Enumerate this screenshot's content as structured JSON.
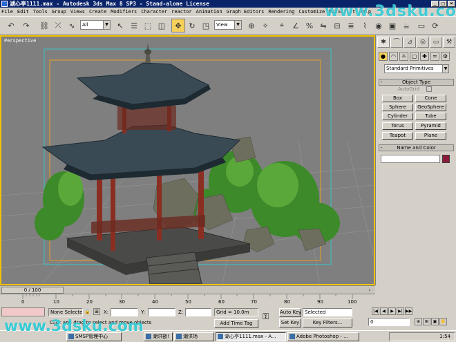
{
  "window": {
    "title": "湖心亭1111.max - Autodesk 3ds Max 8 SP3 - Stand-alone License",
    "min": "_",
    "max": "□",
    "close": "×"
  },
  "menu": [
    "File",
    "Edit",
    "Tools",
    "Group",
    "Views",
    "Create",
    "Modifiers",
    "Character",
    "reactor",
    "Animation",
    "Graph Editors",
    "Rendering",
    "Customize",
    "MAXScript",
    "Help"
  ],
  "toolbar": {
    "selection_filter": "All",
    "ref_coord": "View"
  },
  "viewport": {
    "label": "Perspective"
  },
  "command_panel": {
    "category_dropdown": "Standard Primitives",
    "object_type_header": "Object Type",
    "autogrid_label": "AutoGrid",
    "objects": [
      "Box",
      "Cone",
      "Sphere",
      "GeoSphere",
      "Cylinder",
      "Tube",
      "Torus",
      "Pyramid",
      "Teapot",
      "Plane"
    ],
    "name_color_header": "Name and Color"
  },
  "timeline": {
    "frame_display": "0 / 100",
    "ticks": [
      "0",
      "10",
      "20",
      "30",
      "40",
      "50",
      "60",
      "70",
      "80",
      "90",
      "100"
    ]
  },
  "status": {
    "selection_state": "None Selecte",
    "prompt": "Click and drag to select and move objects",
    "x_label": "X:",
    "y_label": "Y:",
    "z_label": "Z:",
    "grid": "Grid = 10.0m",
    "add_time_tag": "Add Time Tag",
    "auto_key": "Auto Key",
    "set_key": "Set Key",
    "key_mode": "Selected",
    "key_filters": "Key Filters...",
    "current_frame": "0"
  },
  "taskbar": {
    "tasks": [
      "SMSP管理中心",
      "潮洪嵌!",
      "潮洪场",
      "湖心亭1111.max - A...",
      "Adobe Photoshop - ..."
    ],
    "clock": "1:54"
  },
  "watermark": {
    "top": "www.3dsku.com",
    "bottom": "www.3dsku.com"
  },
  "accent_colors": {
    "title_bar": "#0a246a",
    "viewport_border": "#f2c200",
    "active_tool": "#f5d05a"
  }
}
